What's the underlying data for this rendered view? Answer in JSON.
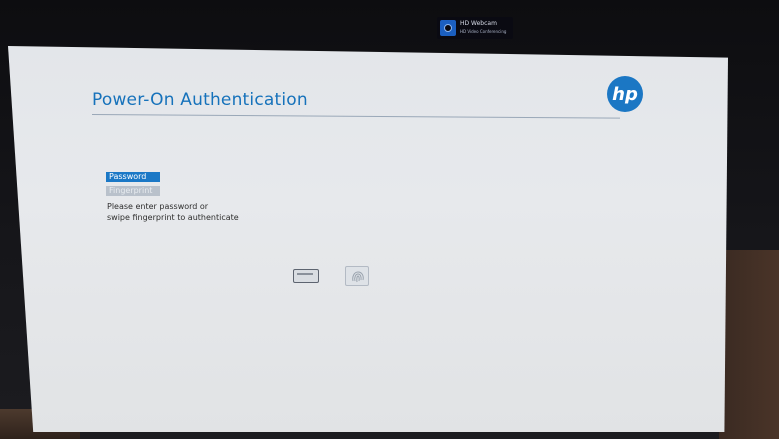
{
  "webcam": {
    "title": "HD Webcam",
    "subtitle": "HD Video Conferencing",
    "icon": "webcam-icon"
  },
  "auth": {
    "title": "Power-On Authentication",
    "logo_text": "hp",
    "options": [
      {
        "label": "Password",
        "selected": true
      },
      {
        "label": "Fingerprint",
        "selected": false
      }
    ],
    "instruction_line1": "Please enter password or",
    "instruction_line2": "swipe fingerprint to authenticate",
    "icons": [
      "keyboard-icon",
      "fingerprint-icon"
    ]
  },
  "colors": {
    "accent": "#1b78c6",
    "screen_bg": "#e5e7ea",
    "disabled": "#b9c1cb"
  }
}
